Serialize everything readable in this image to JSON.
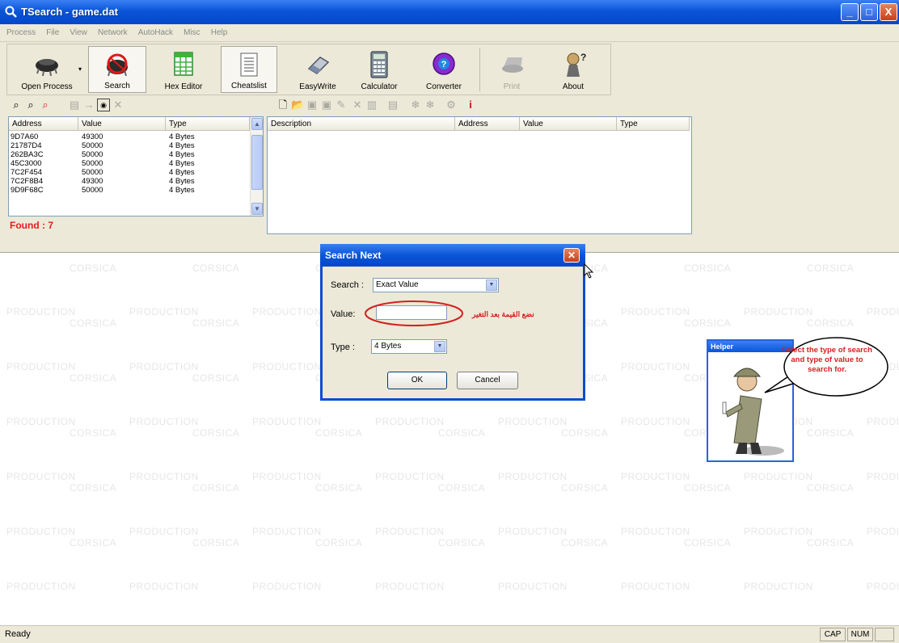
{
  "window": {
    "title": "TSearch - game.dat",
    "caption_buttons": [
      "_",
      "□",
      "X"
    ]
  },
  "menu": [
    "Process",
    "File",
    "View",
    "Network",
    "AutoHack",
    "Misc",
    "Help"
  ],
  "toolbar": {
    "buttons": [
      {
        "label": "Open Process",
        "icon": "chip-icon"
      },
      {
        "label": "Search",
        "icon": "chip-search-icon",
        "pressed": true
      },
      {
        "label": "Hex Editor",
        "icon": "grid-icon"
      },
      {
        "label": "Cheatslist",
        "icon": "list-icon",
        "pressed": true
      },
      {
        "label": "EasyWrite",
        "icon": "eraser-icon"
      },
      {
        "label": "Calculator",
        "icon": "calculator-icon"
      },
      {
        "label": "Converter",
        "icon": "globe-icon"
      },
      {
        "label": "Print",
        "icon": "print-icon",
        "disabled": true
      },
      {
        "label": "About",
        "icon": "about-icon"
      }
    ]
  },
  "results": {
    "columns": [
      "Address",
      "Value",
      "Type"
    ],
    "rows": [
      {
        "address": "9D7A60",
        "value": "49300",
        "type": "4 Bytes"
      },
      {
        "address": "21787D4",
        "value": "50000",
        "type": "4 Bytes"
      },
      {
        "address": "262BA3C",
        "value": "50000",
        "type": "4 Bytes"
      },
      {
        "address": "45C3000",
        "value": "50000",
        "type": "4 Bytes"
      },
      {
        "address": "7C2F454",
        "value": "50000",
        "type": "4 Bytes"
      },
      {
        "address": "7C2F8B4",
        "value": "49300",
        "type": "4 Bytes"
      },
      {
        "address": "9D9F68C",
        "value": "50000",
        "type": "4 Bytes"
      }
    ],
    "found": "Found : 7"
  },
  "cheatlist": {
    "columns": [
      "Description",
      "Address",
      "Value",
      "Type"
    ]
  },
  "watermark": {
    "line1": "CORSICA",
    "line2": "PRODUCTION"
  },
  "dialog": {
    "title": "Search Next",
    "search_label": "Search :",
    "search_value": "Exact Value",
    "value_label": "Value:",
    "value_input": "",
    "type_label": "Type :",
    "type_value": "4 Bytes",
    "ok": "OK",
    "cancel": "Cancel"
  },
  "annotation": {
    "text": "نضع القيمة بعد التغير",
    "color": "#d42020"
  },
  "helper": {
    "title": "Helper",
    "bubble": "Select the type of search and type of value to search for."
  },
  "statusbar": {
    "ready": "Ready",
    "cap": "CAP",
    "num": "NUM"
  },
  "colors": {
    "titlebar": "#0a55d8",
    "face": "#ece9d8",
    "found": "#e02020"
  }
}
